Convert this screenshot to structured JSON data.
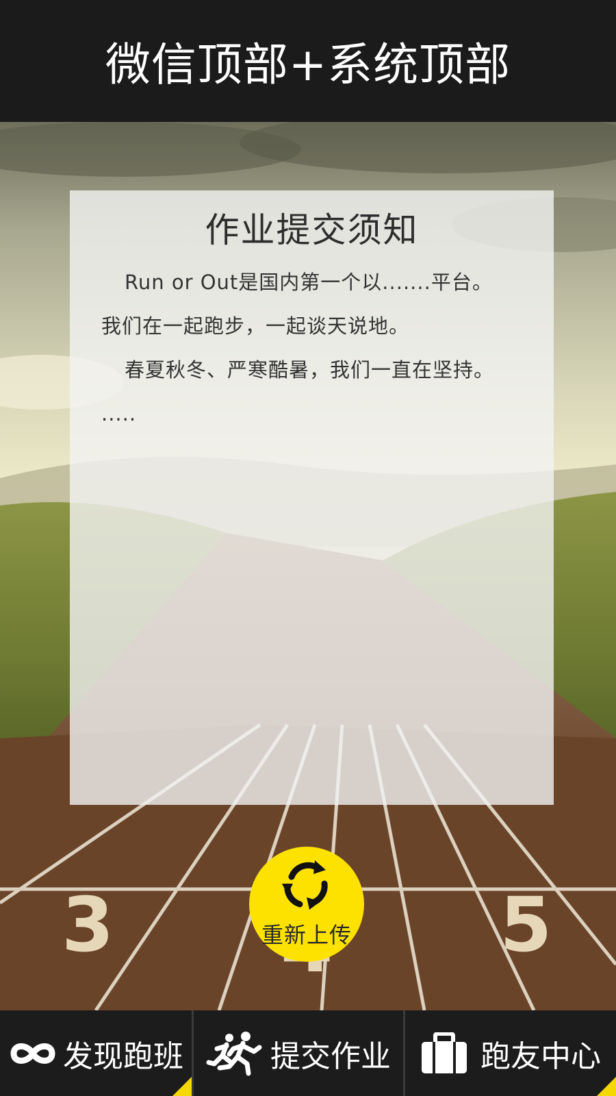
{
  "header": {
    "title": "微信顶部+系统顶部"
  },
  "notice": {
    "title": "作业提交须知",
    "paragraphs": [
      "Run or Out是国内第一个以.......平台。",
      "我们在一起跑步，一起谈天说地。",
      "春夏秋冬、严寒酷暑，我们一直在坚持。",
      "....."
    ]
  },
  "reupload": {
    "label": "重新上传",
    "icon": "refresh-icon"
  },
  "bottom_nav": {
    "items": [
      {
        "label": "发现跑班",
        "icon": "infinity-icon"
      },
      {
        "label": "提交作业",
        "icon": "runners-icon"
      },
      {
        "label": "跑友中心",
        "icon": "briefcase-icon"
      }
    ]
  },
  "colors": {
    "header_bg": "#1b1b1b",
    "accent_yellow": "#fde200",
    "nav_bg": "#1c1c1c"
  }
}
